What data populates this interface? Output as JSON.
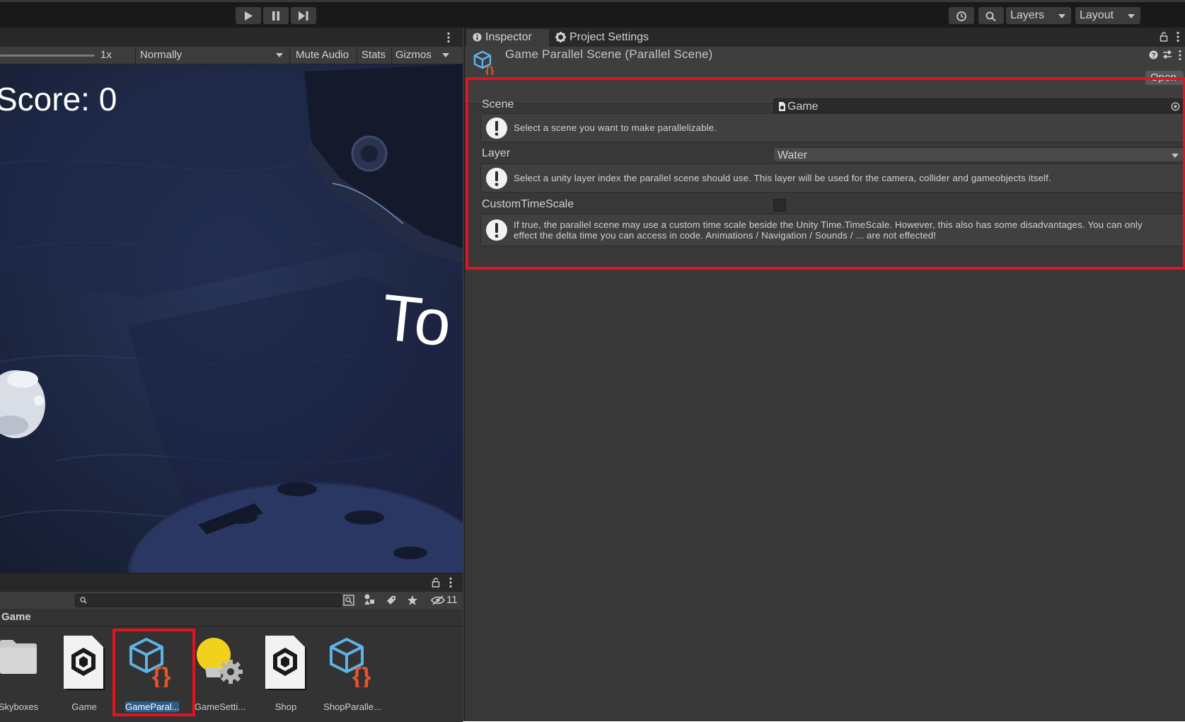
{
  "toolbar": {
    "layers_label": "Layers",
    "layout_label": "Layout"
  },
  "game_view": {
    "scale_label": "1x",
    "vsync_label": "Normally",
    "mute_audio_label": "Mute Audio",
    "stats_label": "Stats",
    "gizmos_label": "Gizmos",
    "score_text": "Score: 0",
    "partial_text": "To"
  },
  "project": {
    "search_placeholder": "",
    "hidden_count": "11",
    "breadcrumb": "Game",
    "assets": [
      {
        "label": "Skyboxes",
        "icon": "folder-icon"
      },
      {
        "label": "Game",
        "icon": "unity-scene-icon"
      },
      {
        "label": "GameParal...",
        "icon": "parallel-scene-icon",
        "selected": true
      },
      {
        "label": "GameSetti...",
        "icon": "lightbulb-gear-icon"
      },
      {
        "label": "Shop",
        "icon": "unity-scene-icon"
      },
      {
        "label": "ShopParalle...",
        "icon": "parallel-scene-icon"
      }
    ]
  },
  "inspector": {
    "tab_inspector": "Inspector",
    "tab_project_settings": "Project Settings",
    "title": "Game Parallel Scene (Parallel Scene)",
    "open_button": "Open",
    "scene_label": "Scene",
    "scene_value": "Game",
    "scene_help": "Select a scene you want to make parallelizable.",
    "layer_label": "Layer",
    "layer_value": "Water",
    "layer_help": "Select a unity layer index the parallel scene should use. This layer will be used for the camera, collider and gameobjects itself.",
    "timescale_label": "CustomTimeScale",
    "timescale_checked": false,
    "timescale_help_line1": "If true, the parallel scene may use a custom time scale beside the Unity Time.TimeScale. However, this also has some disadvantages. You can only",
    "timescale_help_line2": "effect the delta time you can access in code. Animations / Navigation / Sounds / ... are not effected!"
  },
  "colors": {
    "highlight": "#e0141e",
    "selection": "#2c5d87",
    "scene_bg": "#1f2a44",
    "cube_blue": "#5fb3e8",
    "brace_orange": "#e8542a"
  }
}
